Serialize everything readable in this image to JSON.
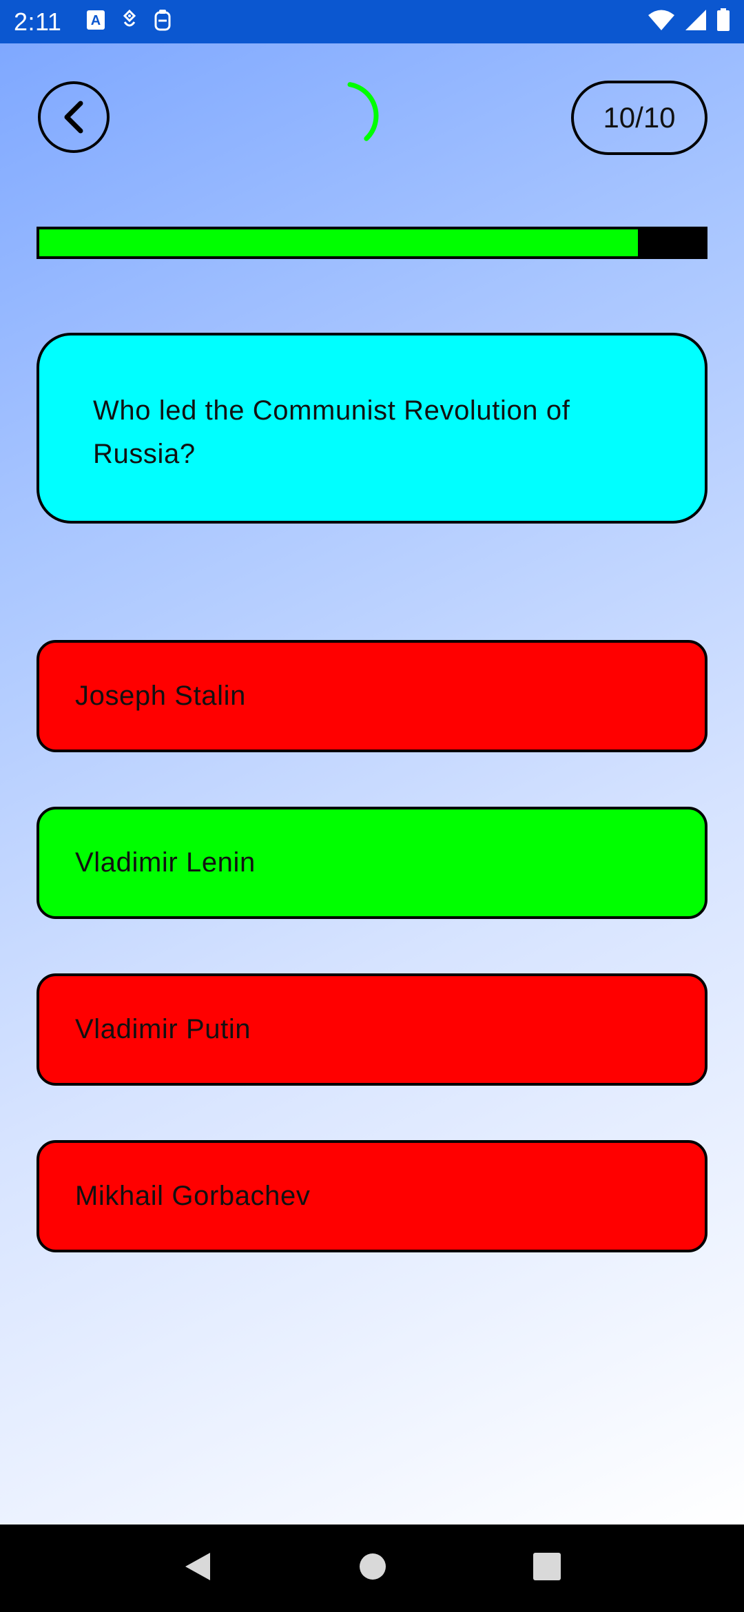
{
  "status_bar": {
    "time": "2:11",
    "left_icons": [
      "font-icon",
      "usb-debug-icon",
      "clipboard-icon"
    ],
    "right_icons": [
      "wifi-icon",
      "signal-icon",
      "battery-icon"
    ]
  },
  "quiz": {
    "score": "10/10",
    "progress": 0.9,
    "timer_remaining_fraction": 0.35,
    "question": "Who led the Communist Revolution of Russia?",
    "answers": [
      {
        "label": "Joseph Stalin",
        "state": "wrong"
      },
      {
        "label": "Vladimir Lenin",
        "state": "correct"
      },
      {
        "label": "Vladimir Putin",
        "state": "wrong"
      },
      {
        "label": "Mikhail Gorbachev",
        "state": "wrong"
      }
    ]
  },
  "colors": {
    "status_bar": "#0b57d0",
    "correct": "#00ff00",
    "wrong": "#ff0000",
    "question_card": "#00ffff",
    "timer": "#00ff00"
  },
  "nav_bar": {
    "buttons": [
      "back-triangle-icon",
      "home-circle-icon",
      "recents-square-icon"
    ]
  }
}
